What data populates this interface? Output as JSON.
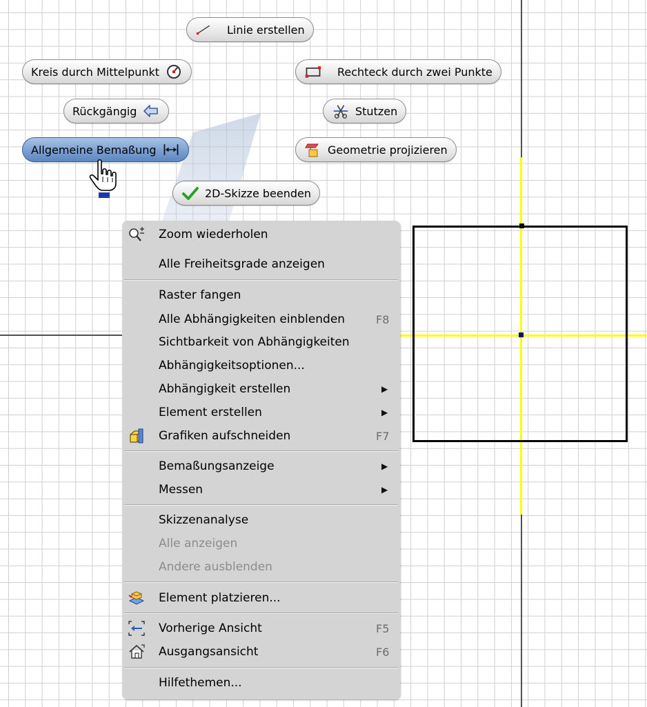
{
  "canvas": {
    "accent_color": "#ffff00",
    "grid_color": "#cfd0d4"
  },
  "marking_menu": {
    "line": {
      "label": "Linie erstellen",
      "icon": "line-icon"
    },
    "circle": {
      "label": "Kreis durch Mittelpunkt",
      "icon": "circle-center-icon"
    },
    "rectangle": {
      "label": "Rechteck durch zwei Punkte",
      "icon": "rectangle-icon"
    },
    "undo": {
      "label": "Rückgängig",
      "icon": "undo-arrow-icon"
    },
    "trim": {
      "label": "Stutzen",
      "icon": "scissors-icon"
    },
    "dimension": {
      "label": "Allgemeine Bemaßung",
      "icon": "dimension-icon"
    },
    "project_geometry": {
      "label": "Geometrie projizieren",
      "icon": "project-geometry-icon"
    },
    "finish_sketch": {
      "label": "2D-Skizze beenden",
      "icon": "checkmark-icon"
    }
  },
  "context_menu": {
    "zoom_repeat": {
      "label": "Zoom wiederholen",
      "icon": "zoom-icon"
    },
    "show_dof": {
      "label": "Alle Freiheitsgrade anzeigen"
    },
    "snap_grid": {
      "label": "Raster fangen"
    },
    "show_constraints": {
      "label": "Alle Abhängigkeiten einblenden",
      "shortcut": "F8"
    },
    "constraint_visibility": {
      "label": "Sichtbarkeit von Abhängigkeiten"
    },
    "constraint_options": {
      "label": "Abhängigkeitsoptionen..."
    },
    "create_constraint": {
      "label": "Abhängigkeit erstellen",
      "submenu": "▶"
    },
    "create_feature": {
      "label": "Element erstellen",
      "submenu": "▶"
    },
    "slice_graphics": {
      "label": "Grafiken aufschneiden",
      "shortcut": "F7",
      "icon": "slice-graphics-icon"
    },
    "dimension_display": {
      "label": "Bemaßungsanzeige",
      "submenu": "▶"
    },
    "measure": {
      "label": "Messen",
      "submenu": "▶"
    },
    "sketch_analysis": {
      "label": "Skizzenanalyse"
    },
    "show_all": {
      "label": "Alle anzeigen"
    },
    "hide_others": {
      "label": "Andere ausblenden"
    },
    "place_feature": {
      "label": "Element platzieren...",
      "icon": "place-feature-icon"
    },
    "previous_view": {
      "label": "Vorherige Ansicht",
      "shortcut": "F5",
      "icon": "previous-view-icon"
    },
    "home_view": {
      "label": "Ausgangsansicht",
      "shortcut": "F6",
      "icon": "home-icon"
    },
    "help": {
      "label": "Hilfethemen..."
    }
  }
}
